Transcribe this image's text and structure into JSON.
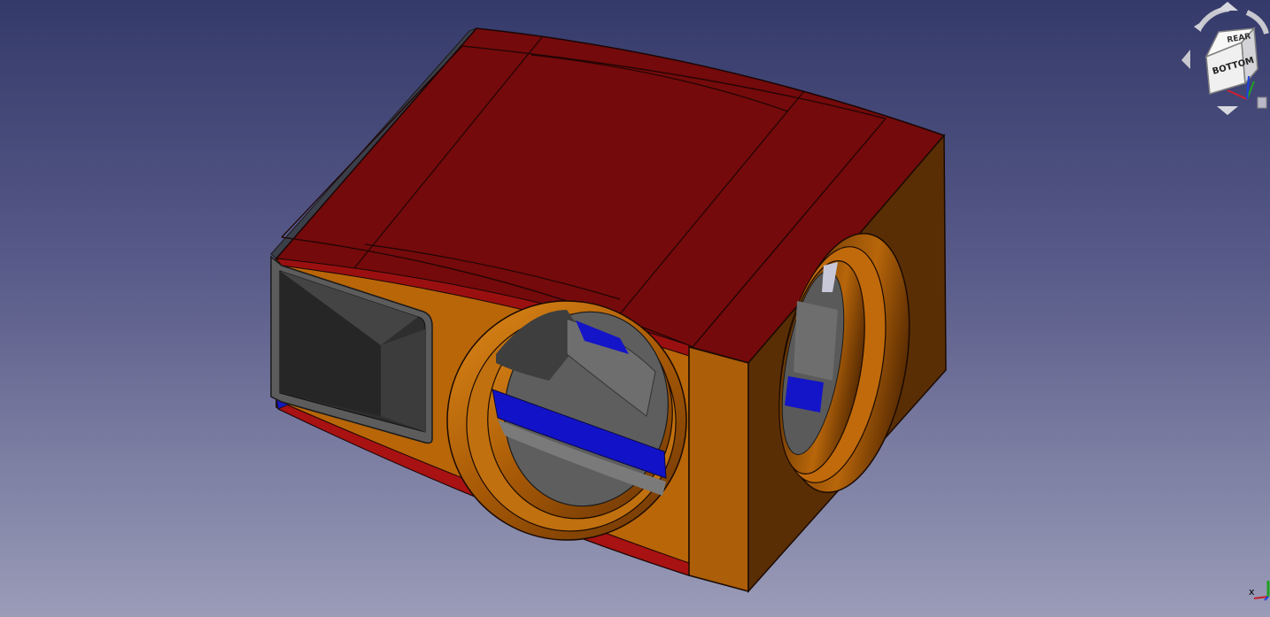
{
  "navigation_cube": {
    "face_top": "REAR",
    "face_front": "BOTTOM",
    "edge_color": "#9c9c9c"
  },
  "axis_triad": {
    "x_label": "x",
    "x_color": "#c0202a",
    "y_color": "#20a020",
    "z_color": "#2040e0"
  },
  "colors": {
    "background_top": "#343a6a",
    "background_bottom": "#9a9cb8",
    "panel_red": "#7a0c0c",
    "body_orange": "#b76608",
    "inner_gray": "#4a4a4a",
    "strip_blue": "#1010c8"
  }
}
